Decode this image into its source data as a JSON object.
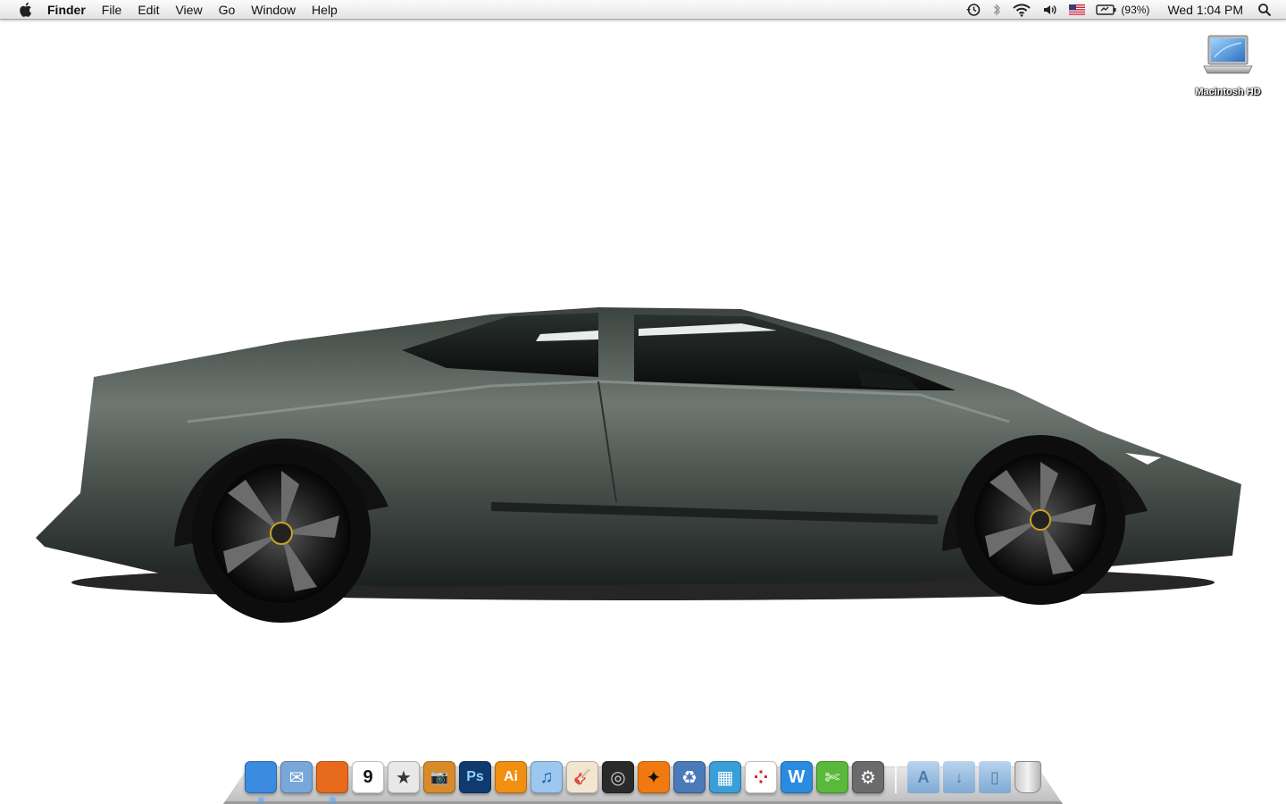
{
  "menubar": {
    "app_name": "Finder",
    "menus": [
      "File",
      "Edit",
      "View",
      "Go",
      "Window",
      "Help"
    ],
    "battery_percent": "(93%)",
    "clock": "Wed 1:04 PM"
  },
  "desktop": {
    "hd_label": "Macintosh HD"
  },
  "dock": {
    "apps": [
      {
        "name": "finder-icon",
        "glyph": "",
        "bg": "#3b8be0",
        "fg": "#fff",
        "running": true
      },
      {
        "name": "mail-icon",
        "glyph": "✉",
        "bg": "#7aa7d9",
        "fg": "#fff",
        "running": false
      },
      {
        "name": "firefox-icon",
        "glyph": "",
        "bg": "#e86a1c",
        "fg": "#fff",
        "running": true
      },
      {
        "name": "ical-icon",
        "glyph": "9",
        "bg": "#ffffff",
        "fg": "#111",
        "running": false
      },
      {
        "name": "imovie-icon",
        "glyph": "★",
        "bg": "#e8e8e8",
        "fg": "#333",
        "running": false
      },
      {
        "name": "iphoto-icon",
        "glyph": "📷",
        "bg": "#d98a2a",
        "fg": "#fff",
        "running": false
      },
      {
        "name": "photoshop-icon",
        "glyph": "Ps",
        "bg": "#0e3a70",
        "fg": "#8fd0ff",
        "running": false
      },
      {
        "name": "illustrator-icon",
        "glyph": "Ai",
        "bg": "#f08f10",
        "fg": "#fff",
        "running": false
      },
      {
        "name": "itunes-icon",
        "glyph": "♫",
        "bg": "#9cc8ef",
        "fg": "#1a5db0",
        "running": false
      },
      {
        "name": "garageband-icon",
        "glyph": "🎸",
        "bg": "#f1e6d0",
        "fg": "#8a4a10",
        "running": false
      },
      {
        "name": "dvd-player-icon",
        "glyph": "◎",
        "bg": "#2a2a2a",
        "fg": "#ccc",
        "running": false
      },
      {
        "name": "reason-icon",
        "glyph": "✦",
        "bg": "#f07a10",
        "fg": "#111",
        "running": false
      },
      {
        "name": "recycle-app-icon",
        "glyph": "♻",
        "bg": "#4a7ab8",
        "fg": "#fff",
        "running": false
      },
      {
        "name": "network-utility-icon",
        "glyph": "▦",
        "bg": "#3a9ed8",
        "fg": "#fff",
        "running": false
      },
      {
        "name": "grid-app-icon",
        "glyph": "⁘",
        "bg": "#ffffff",
        "fg": "#d0202a",
        "running": false
      },
      {
        "name": "wacom-icon",
        "glyph": "W",
        "bg": "#2a8ce0",
        "fg": "#fff",
        "running": false
      },
      {
        "name": "utility-icon",
        "glyph": "✄",
        "bg": "#5ab83a",
        "fg": "#fff",
        "running": false
      },
      {
        "name": "system-preferences-icon",
        "glyph": "⚙",
        "bg": "#6b6b6b",
        "fg": "#fff",
        "running": false
      }
    ],
    "folders": [
      {
        "name": "applications-folder-icon",
        "glyph": "A"
      },
      {
        "name": "downloads-folder-icon",
        "glyph": "↓"
      },
      {
        "name": "documents-folder-icon",
        "glyph": "▯"
      }
    ]
  }
}
